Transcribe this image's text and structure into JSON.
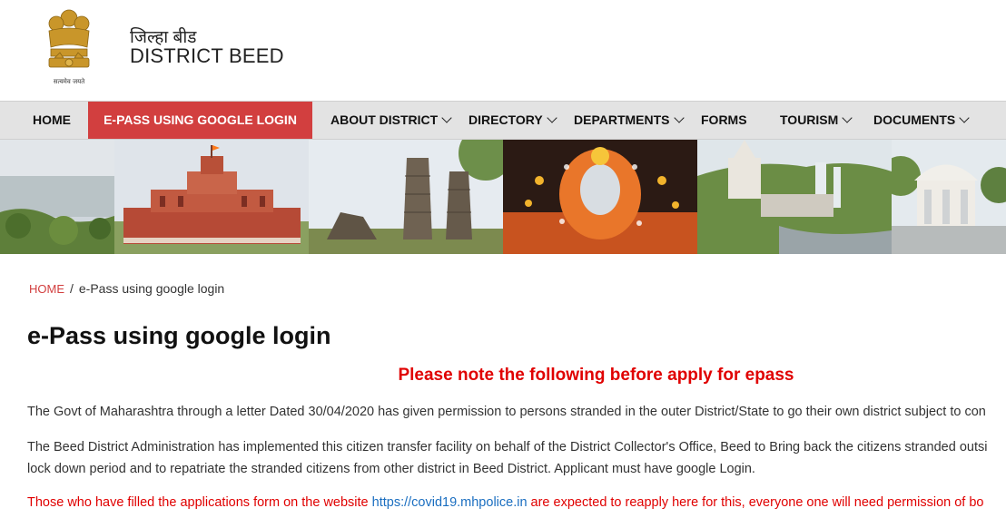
{
  "header": {
    "title_hindi": "जिल्हा बीड",
    "title_english": "DISTRICT BEED",
    "emblem_motto": "सत्यमेव जयते"
  },
  "nav": {
    "items": [
      {
        "label": "HOME",
        "dropdown": false
      },
      {
        "label": "E-PASS USING GOOGLE LOGIN",
        "dropdown": false,
        "active": true
      },
      {
        "label": "ABOUT DISTRICT",
        "dropdown": true
      },
      {
        "label": "DIRECTORY",
        "dropdown": true
      },
      {
        "label": "DEPARTMENTS",
        "dropdown": true
      },
      {
        "label": "FORMS",
        "dropdown": false
      },
      {
        "label": "TOURISM",
        "dropdown": true
      },
      {
        "label": "DOCUMENTS",
        "dropdown": true
      }
    ],
    "active_color": "#d23f3f",
    "bar_color": "#e3e3e3"
  },
  "breadcrumb": {
    "home": "HOME",
    "separator": "/",
    "current": "e-Pass using google login"
  },
  "page_title": "e-Pass using google login",
  "notice_heading": "Please note the following before apply for epass",
  "paragraphs": {
    "p1": "The Govt of Maharashtra through a letter Dated 30/04/2020 has given permission to persons stranded in the outer District/State to go their own district subject to con",
    "p2_line1": "The Beed District Administration has implemented this citizen transfer facility on behalf of the District Collector's Office, Beed to Bring back the citizens stranded outsi",
    "p2_line2": "lock down period and to repatriate the stranded citizens from other district in Beed District. Applicant must have google Login.",
    "p3_before": "Those who have filled the applications form on the website ",
    "p3_link": "https://covid19.mhpolice.in",
    "p3_after": " are expected to reapply here for this, everyone one will need permission of bo"
  },
  "colors": {
    "accent_red": "#d23f3f",
    "notice_red": "#e00000",
    "link_blue": "#1a6ec0"
  }
}
